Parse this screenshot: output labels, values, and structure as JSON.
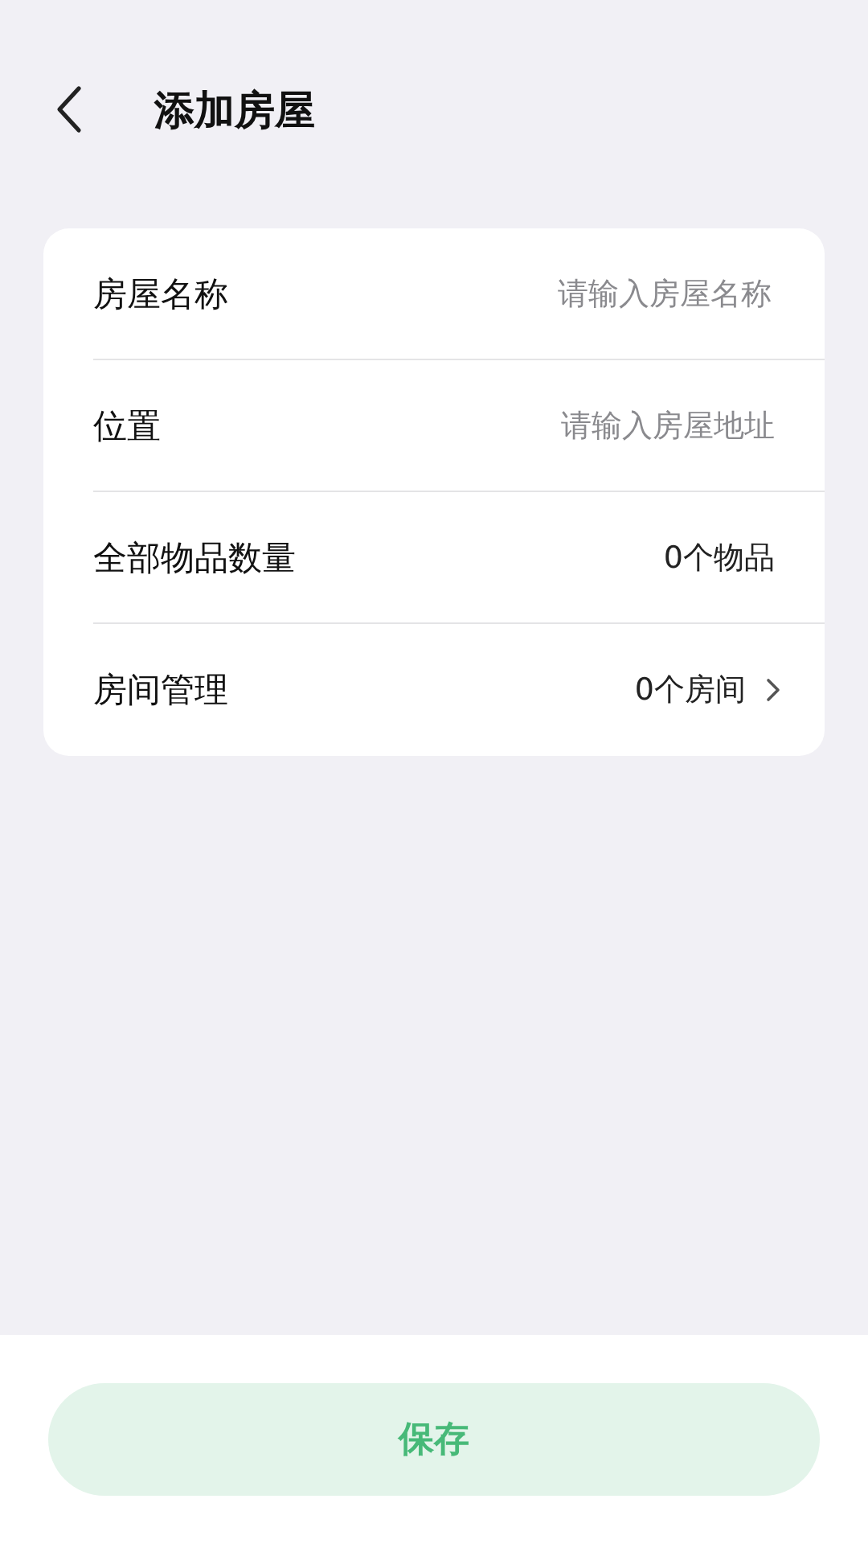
{
  "header": {
    "title": "添加房屋"
  },
  "rows": [
    {
      "kind": "input",
      "label": "房屋名称",
      "placeholder": "请输入房屋名称"
    },
    {
      "kind": "value",
      "label": "位置",
      "placeholder": "请输入房屋地址"
    },
    {
      "kind": "value",
      "label": "全部物品数量",
      "value": "0个物品"
    },
    {
      "kind": "link",
      "label": "房间管理",
      "value": "0个房间"
    }
  ],
  "save_button": {
    "label": "保存",
    "disabled": true
  }
}
